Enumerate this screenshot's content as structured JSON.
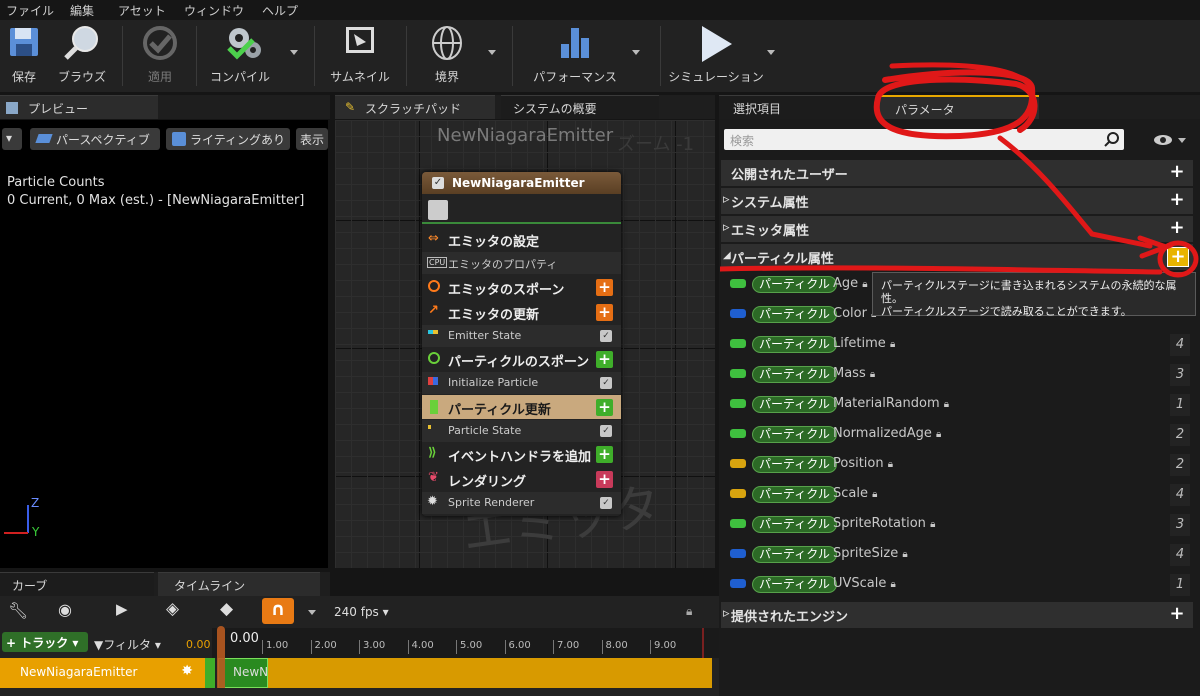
{
  "menu": [
    "ファイル",
    "編集",
    "アセット",
    "ウィンドウ",
    "ヘルプ"
  ],
  "toolbar": {
    "save": "保存",
    "browse": "ブラウズ",
    "apply": "適用",
    "compile": "コンパイル",
    "thumbnail": "サムネイル",
    "bounds": "境界",
    "performance": "パフォーマンス",
    "simulation": "シミュレーション"
  },
  "preview": {
    "tab": "プレビュー",
    "perspective": "パースペクティブ",
    "lighting": "ライティングあり",
    "show": "表示",
    "stats_title": "Particle Counts",
    "stats_line": "0 Current, 0 Max (est.) - [NewNiagaraEmitter]",
    "axis_z": "Z",
    "axis_y": "Y"
  },
  "graph": {
    "tabs": [
      "スクラッチパッド",
      "システムの概要"
    ],
    "title": "NewNiagaraEmitter",
    "zoom": "ズーム -1",
    "watermark": "エミッタ"
  },
  "node": {
    "title": "NewNiagaraEmitter",
    "rows": [
      {
        "label": "エミッタの設定"
      },
      {
        "label": "エミッタのプロパティ"
      },
      {
        "label": "エミッタのスポーン"
      },
      {
        "label": "エミッタの更新"
      },
      {
        "label": "Emitter State"
      },
      {
        "label": "パーティクルのスポーン"
      },
      {
        "label": "Initialize Particle"
      },
      {
        "label": "パーティクル更新"
      },
      {
        "label": "Particle State"
      },
      {
        "label": "イベントハンドラを追加"
      },
      {
        "label": "レンダリング"
      },
      {
        "label": "Sprite Renderer"
      }
    ]
  },
  "right": {
    "tabs": [
      "選択項目",
      "パラメータ"
    ],
    "search_placeholder": "検索",
    "categories": [
      "公開されたユーザー",
      "システム属性",
      "エミッタ属性",
      "パーティクル属性",
      "提供されたエンジン"
    ],
    "tooltip_line1": "パーティクルステージに書き込まれるシステムの永続的な属性。",
    "tooltip_line2": "パーティクルステージで読み取ることができます。",
    "tag": "パーティクル",
    "params": [
      {
        "name": "Age",
        "count": "",
        "color": "#3fbf3f"
      },
      {
        "name": "Color",
        "count": "",
        "color": "#1f5fd0"
      },
      {
        "name": "Lifetime",
        "count": "4",
        "color": "#3fbf3f"
      },
      {
        "name": "Mass",
        "count": "3",
        "color": "#3fbf3f"
      },
      {
        "name": "MaterialRandom",
        "count": "1",
        "color": "#3fbf3f"
      },
      {
        "name": "NormalizedAge",
        "count": "2",
        "color": "#3fbf3f"
      },
      {
        "name": "Position",
        "count": "2",
        "color": "#d8a40f"
      },
      {
        "name": "Scale",
        "count": "4",
        "color": "#d8a40f"
      },
      {
        "name": "SpriteRotation",
        "count": "3",
        "color": "#3fbf3f"
      },
      {
        "name": "SpriteSize",
        "count": "4",
        "color": "#1f5fd0"
      },
      {
        "name": "UVScale",
        "count": "1",
        "color": "#1f5fd0"
      }
    ]
  },
  "bottom": {
    "tabs": [
      "カーブ",
      "タイムライン"
    ],
    "fps": "240 fps",
    "track": "トラック",
    "filter": "フィルタ",
    "time_small": "0.00",
    "time_head": "0.00",
    "ticks": [
      "1.00",
      "2.00",
      "3.00",
      "4.00",
      "5.00",
      "6.00",
      "7.00",
      "8.00",
      "9.00"
    ],
    "emitter_track": "NewNiagaraEmitter",
    "clip": "NewN"
  }
}
